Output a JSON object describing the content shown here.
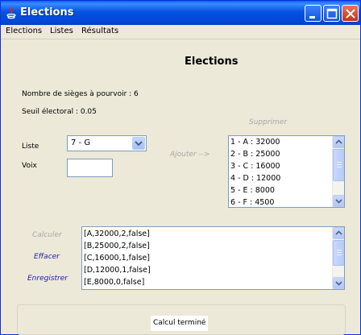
{
  "window": {
    "title": "Elections"
  },
  "menu": [
    "Elections",
    "Listes",
    "Résultats"
  ],
  "main": {
    "title": "Elections",
    "seats_label": "Nombre de sièges à pourvoir : 6",
    "threshold_label": "Seuil électoral : 0.05"
  },
  "form": {
    "liste_label": "Liste",
    "voix_label": "Voix",
    "liste_selected": "7 - G",
    "voix_value": ""
  },
  "actions": {
    "supprimer": "Supprimer",
    "ajouter": "Ajouter -->",
    "calculer": "Calculer",
    "effacer": "Effacer",
    "enregistrer": "Enregistrer"
  },
  "lists": [
    "1 - A : 32000",
    "2 - B : 25000",
    "3 - C : 16000",
    "4 - D : 12000",
    "5 - E : 8000",
    "6 - F : 4500"
  ],
  "results": [
    "[A,32000,2,false]",
    "[B,25000,2,false]",
    "[C,16000,1,false]",
    "[D,12000,1,false]",
    "[E,8000,0,false]"
  ],
  "status": "Calcul terminé",
  "colors": {
    "titlebar": "#0553E3",
    "window_bg": "#ECE9D8",
    "link_active": "#1C1CA8",
    "link_disabled": "#A7A7A7",
    "field_border": "#7F9DB9"
  }
}
